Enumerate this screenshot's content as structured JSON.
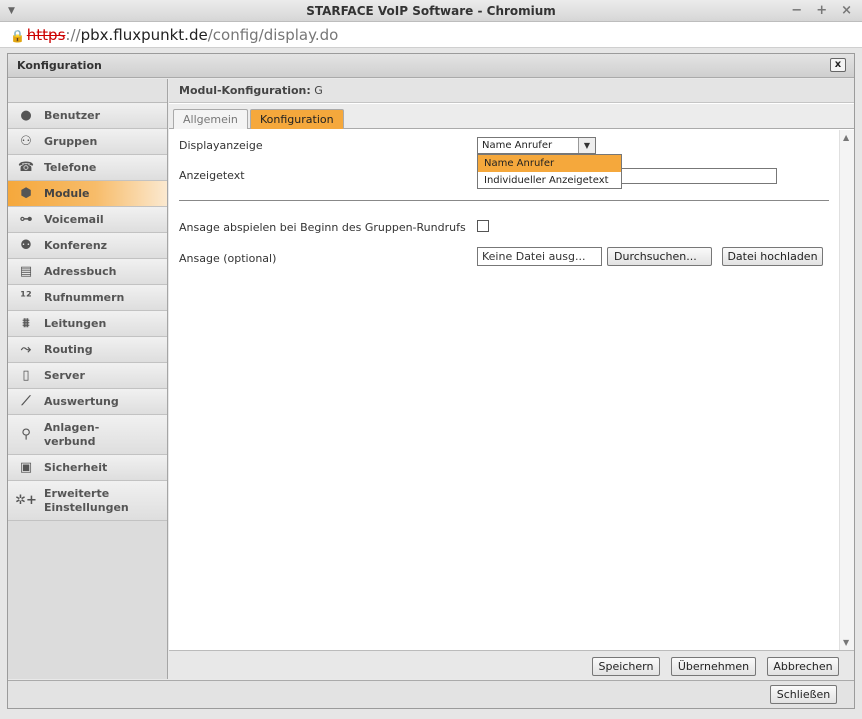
{
  "browser": {
    "title": "STARFACE VoIP Software - Chromium",
    "url_proto": "https",
    "url_sep": "://",
    "url_host": "pbx.fluxpunkt.de",
    "url_path": "/config/display.do"
  },
  "dialog": {
    "title": "Konfiguration",
    "close_label": "x",
    "footer_close_label": "Schließen"
  },
  "sidebar": {
    "items": [
      {
        "label": "Benutzer",
        "icon": "user-icon"
      },
      {
        "label": "Gruppen",
        "icon": "group-icon"
      },
      {
        "label": "Telefone",
        "icon": "phone-icon"
      },
      {
        "label": "Module",
        "icon": "module-icon",
        "active": true
      },
      {
        "label": "Voicemail",
        "icon": "voicemail-icon"
      },
      {
        "label": "Konferenz",
        "icon": "conference-icon"
      },
      {
        "label": "Adressbuch",
        "icon": "addressbook-icon"
      },
      {
        "label": "Rufnummern",
        "icon": "numbers-icon"
      },
      {
        "label": "Leitungen",
        "icon": "lines-icon"
      },
      {
        "label": "Routing",
        "icon": "routing-icon"
      },
      {
        "label": "Server",
        "icon": "server-icon"
      },
      {
        "label": "Auswertung",
        "icon": "chart-icon"
      },
      {
        "label": "Anlagen-\nverbund",
        "icon": "network-icon"
      },
      {
        "label": "Sicherheit",
        "icon": "lock-icon"
      },
      {
        "label": "Erweiterte\nEinstellungen",
        "icon": "settings-plus-icon"
      }
    ]
  },
  "main": {
    "module_label": "Modul-Konfiguration:",
    "module_name": "G",
    "tabs": [
      {
        "label": "Allgemein"
      },
      {
        "label": "Konfiguration",
        "active": true
      }
    ],
    "form": {
      "display_label": "Displayanzeige",
      "display_value": "Name Anrufer",
      "display_options": [
        "Name Anrufer",
        "Individueller Anzeigetext"
      ],
      "text_label": "Anzeigetext",
      "text_value": "",
      "announce_label": "Ansage abspielen bei Beginn des Gruppen-Rundrufs",
      "announce_checked": false,
      "optional_label": "Ansage (optional)",
      "file_placeholder": "Keine Datei ausg...",
      "browse_label": "Durchsuchen...",
      "upload_label": "Datei hochladen"
    },
    "footer": {
      "save_label": "Speichern",
      "apply_label": "Übernehmen",
      "cancel_label": "Abbrechen"
    }
  },
  "colors": {
    "accent": "#f5a83c"
  }
}
